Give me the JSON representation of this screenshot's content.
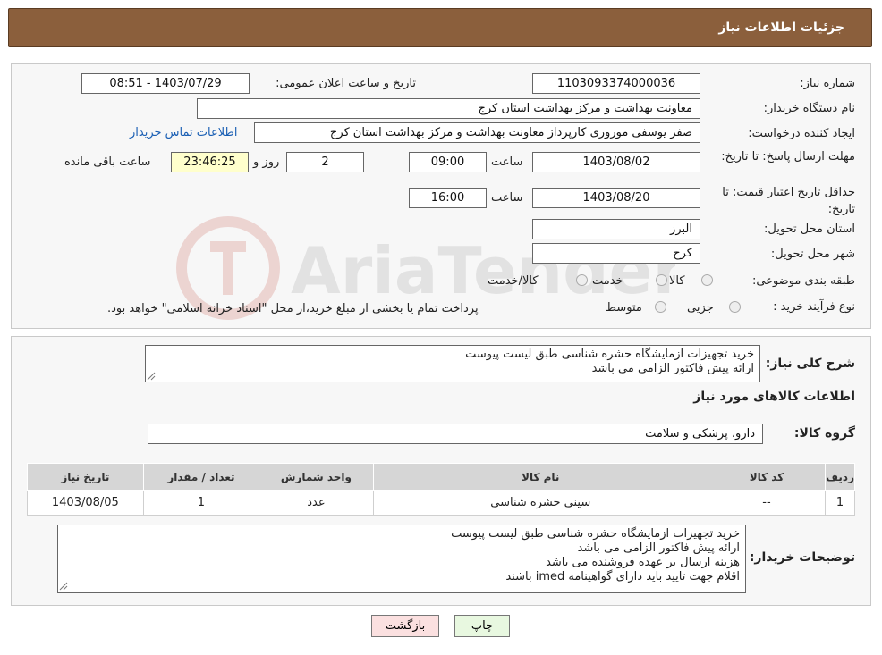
{
  "header": {
    "title": "جزئیات اطلاعات نیاز"
  },
  "form": {
    "need_number": {
      "label": "شماره نیاز:",
      "value": "1103093374000036"
    },
    "announce": {
      "label": "تاریخ و ساعت اعلان عمومی:",
      "value": "1403/07/29 - 08:51"
    },
    "buyer": {
      "label": "نام دستگاه خریدار:",
      "value": "معاونت بهداشت و مرکز بهداشت استان کرج"
    },
    "creator": {
      "label": "ایجاد کننده درخواست:",
      "value": "صفر یوسفی موروری کارپرداز معاونت بهداشت و مرکز بهداشت استان کرج",
      "contact_link": "اطلاعات تماس خریدار"
    },
    "deadline": {
      "label": "مهلت ارسال پاسخ: تا تاریخ:",
      "date": "1403/08/02",
      "time_label": "ساعت",
      "time": "09:00",
      "days": "2",
      "days_label": "روز و",
      "remaining": "23:46:25",
      "remaining_label": "ساعت باقی مانده"
    },
    "price_validity": {
      "label": "حداقل تاریخ اعتبار قیمت: تا تاریخ:",
      "date": "1403/08/20",
      "time_label": "ساعت",
      "time": "16:00"
    },
    "province": {
      "label": "استان محل تحویل:",
      "value": "البرز"
    },
    "city": {
      "label": "شهر محل تحویل:",
      "value": "کرج"
    },
    "category": {
      "label": "طبقه بندی موضوعی:",
      "options": [
        "کالا",
        "خدمت",
        "کالا/خدمت"
      ]
    },
    "purchase_type": {
      "label": "نوع فرآیند خرید :",
      "options": [
        "جزیی",
        "متوسط"
      ],
      "note": "پرداخت تمام یا بخشی از مبلغ خرید،از محل \"اسناد خزانه اسلامی\" خواهد بود."
    }
  },
  "details": {
    "summary_label": "شرح کلی نیاز:",
    "summary_text": "خرید تجهیزات ازمایشگاه حشره شناسی طبق لیست پیوست\nارائه پیش فاکتور الزامی می باشد",
    "goods_section_title": "اطلاعات کالاهای مورد نیاز",
    "group_label": "گروه کالا:",
    "group_value": "دارو، پزشکی و سلامت"
  },
  "table": {
    "headers": [
      "ردیف",
      "کد کالا",
      "نام کالا",
      "واحد شمارش",
      "تعداد / مقدار",
      "تاریخ نیاز"
    ],
    "rows": [
      [
        "1",
        "--",
        "سینی حشره شناسی",
        "عدد",
        "1",
        "1403/08/05"
      ]
    ]
  },
  "buyer_notes": {
    "label": "توضیحات خریدار:",
    "text": "خرید تجهیزات ازمایشگاه حشره شناسی طبق لیست پیوست\nارائه پیش فاکتور الزامی می باشد\nهزینه ارسال بر عهده فروشنده می باشد\nاقلام جهت تایید باید دارای گواهینامه imed باشند"
  },
  "buttons": {
    "print": "چاپ",
    "back": "بازگشت"
  },
  "watermark": {
    "text": "AriaTender.neT"
  },
  "colors": {
    "header_bg": "#8b5f3c",
    "link": "#1a5fb4",
    "print_bg": "#e8f8e0",
    "back_bg": "#fbe0e0"
  }
}
